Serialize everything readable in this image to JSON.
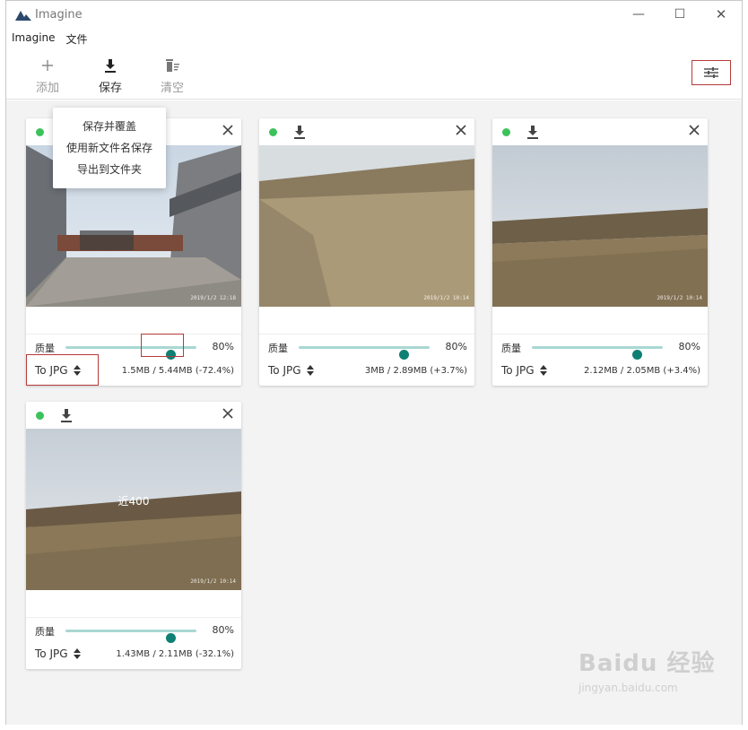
{
  "window": {
    "title": "Imagine",
    "controls": {
      "minimize": "—",
      "maximize": "☐",
      "close": "✕"
    }
  },
  "menu": {
    "items": [
      "Imagine",
      "文件"
    ]
  },
  "toolbar": {
    "add_label": "添加",
    "save_label": "保存",
    "clear_label": "清空",
    "add_icon": "plus-icon",
    "save_icon": "download-icon",
    "clear_icon": "trash-icon",
    "settings_icon": "sliders-icon"
  },
  "save_menu": {
    "items": [
      "保存并覆盖",
      "使用新文件名保存",
      "导出到文件夹"
    ]
  },
  "cards": [
    {
      "quality_label": "质量",
      "quality_value": "80%",
      "quality_level": 0.8,
      "format": "To JPG",
      "size_info": "1.5MB / 5.44MB (-72.4%)",
      "stamp": "2019/1/2 12:18"
    },
    {
      "quality_label": "质量",
      "quality_value": "80%",
      "quality_level": 0.8,
      "format": "To JPG",
      "size_info": "3MB / 2.89MB (+3.7%)",
      "stamp": "2019/1/2 10:14"
    },
    {
      "quality_label": "质量",
      "quality_value": "80%",
      "quality_level": 0.8,
      "format": "To JPG",
      "size_info": "2.12MB / 2.05MB (+3.4%)",
      "stamp": "2019/1/2 10:14"
    },
    {
      "quality_label": "质量",
      "quality_value": "80%",
      "quality_level": 0.8,
      "format": "To JPG",
      "size_info": "1.43MB / 2.11MB (-32.1%)",
      "stamp": "2019/1/2 10:14",
      "overlay_text": "近400"
    }
  ],
  "watermark": {
    "main": "Baidu 经验",
    "sub": "jingyan.baidu.com"
  },
  "colors": {
    "status_ok": "#3cc25a",
    "slider_thumb": "#0e8073",
    "slider_track": "#a9d7d3",
    "highlight": "#b53a3a"
  }
}
